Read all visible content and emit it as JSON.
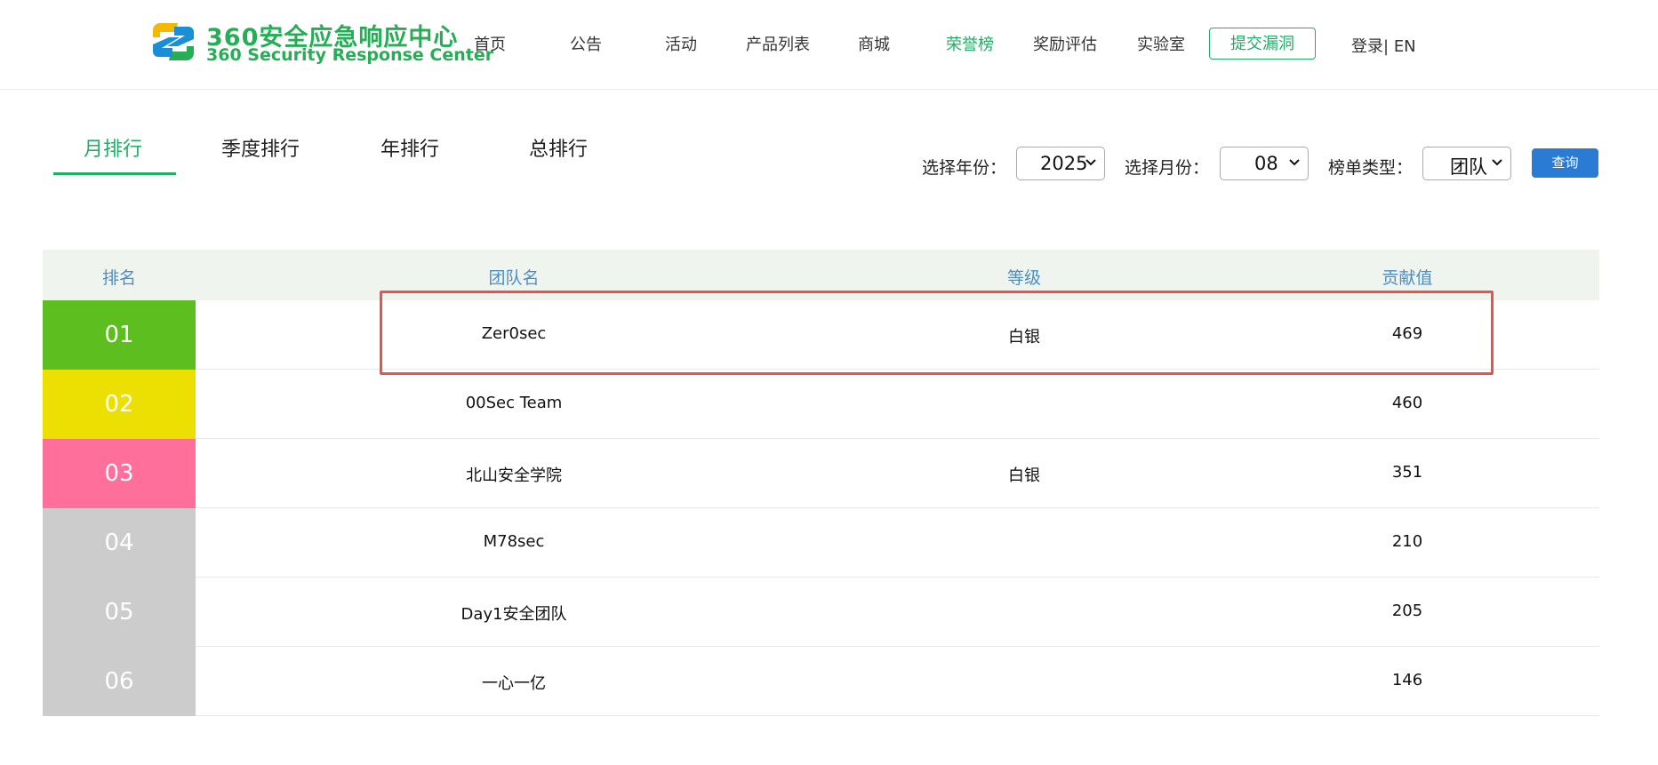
{
  "header": {
    "logo_cn": "360安全应急响应中心",
    "logo_en": "360 Security Response Center",
    "nav": [
      "首页",
      "公告",
      "活动",
      "产品列表",
      "商城",
      "荣誉榜",
      "奖励评估",
      "实验室"
    ],
    "submit_label": "提交漏洞",
    "login_label": "登录",
    "separator": "|",
    "lang_label": "EN",
    "accent_color": "#1fae67"
  },
  "tabs": [
    "月排行",
    "季度排行",
    "年排行",
    "总排行"
  ],
  "filters": {
    "year_label": "选择年份：",
    "year_value": "2025",
    "month_label": "选择月份：",
    "month_value": "08",
    "type_label": "榜单类型：",
    "type_value": "团队",
    "query_label": "查询"
  },
  "table": {
    "headers": [
      "排名",
      "团队名",
      "等级",
      "贡献值"
    ],
    "rows": [
      {
        "rank": "01",
        "team": "Zer0sec",
        "level": "白银",
        "score": "469",
        "color": "#5cbf1f"
      },
      {
        "rank": "02",
        "team": "00Sec Team",
        "level": "",
        "score": "460",
        "color": "#ebe001"
      },
      {
        "rank": "03",
        "team": "北山安全学院",
        "level": "白银",
        "score": "351",
        "color": "#ff6f9c"
      },
      {
        "rank": "04",
        "team": "M78sec",
        "level": "",
        "score": "210",
        "color": "#cccccc"
      },
      {
        "rank": "05",
        "team": "Day1安全团队",
        "level": "",
        "score": "205",
        "color": "#cccccc"
      },
      {
        "rank": "06",
        "team": "一心一亿",
        "level": "",
        "score": "146",
        "color": "#cccccc"
      }
    ]
  }
}
